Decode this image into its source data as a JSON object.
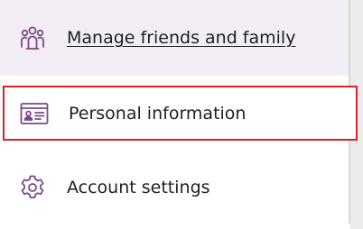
{
  "menu": {
    "items": [
      {
        "label": "Manage friends and family",
        "icon": "people-icon",
        "state": "hovered"
      },
      {
        "label": "Personal information",
        "icon": "id-card-icon",
        "state": "focused"
      },
      {
        "label": "Account settings",
        "icon": "gear-icon",
        "state": "default"
      }
    ]
  },
  "colors": {
    "icon_purple": "#7b4a8c",
    "hover_background": "#f3eef5",
    "focus_border": "#d9232a",
    "text": "#1f1f1f"
  }
}
